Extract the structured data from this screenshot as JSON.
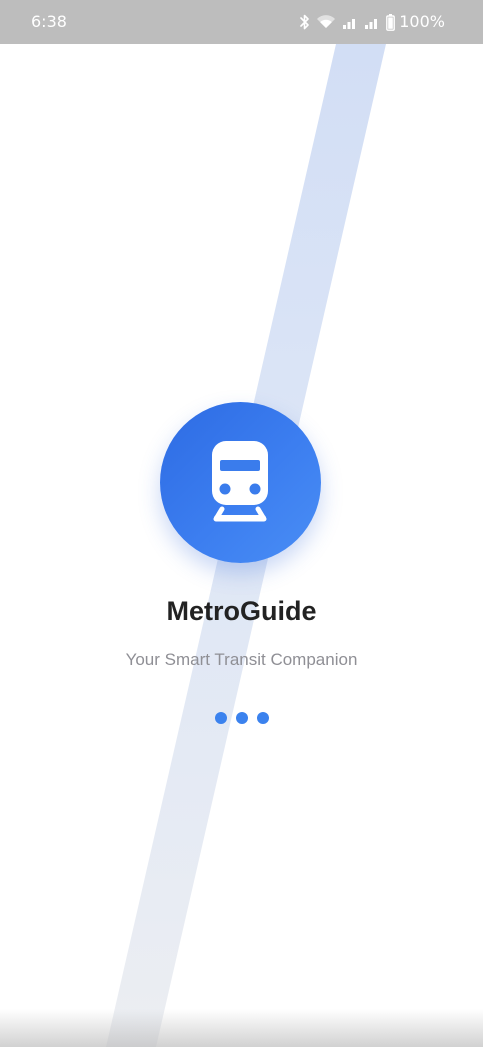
{
  "status_bar": {
    "time": "6:38",
    "battery_percent": "100%",
    "icons": [
      "bluetooth-icon",
      "wifi-icon",
      "signal-icon",
      "signal-icon-2",
      "battery-icon"
    ]
  },
  "splash": {
    "app_name": "MetroGuide",
    "tagline": "Your Smart Transit Companion",
    "logo_icon": "train-icon",
    "loading_dots": 3
  },
  "colors": {
    "accent": "#3b82ee",
    "logo_gradient_start": "#2d6be3",
    "logo_gradient_end": "#4a8ef5",
    "track_stripe": "#dfe7f7",
    "title_text": "#222222",
    "tagline_text": "#8f8f95",
    "status_bar_bg": "#bdbdbd"
  }
}
